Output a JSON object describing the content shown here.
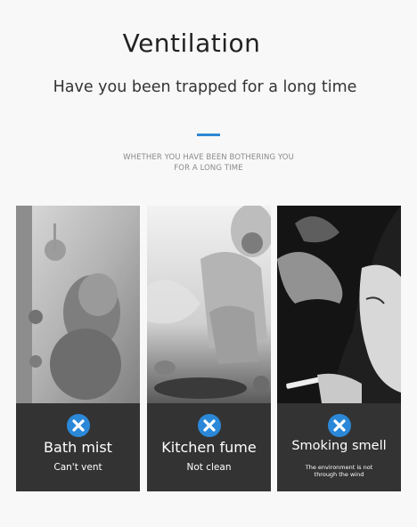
{
  "header": {
    "title": "Ventilation",
    "subtitle": "Have you been trapped for a long time",
    "tagline_line1": "WHETHER YOU HAVE BEEN BOTHERING YOU",
    "tagline_line2": "FOR A LONG TIME"
  },
  "colors": {
    "accent": "#2f87d4",
    "card_bg": "#333333",
    "badge": "#2b88d8"
  },
  "cards": [
    {
      "title": "Bath mist",
      "caption": "Can't vent",
      "icon": "close-icon"
    },
    {
      "title": "Kitchen fume",
      "caption": "Not clean",
      "icon": "close-icon"
    },
    {
      "title": "Smoking smell",
      "caption": "The environment is not through the wind",
      "icon": "close-icon"
    }
  ]
}
